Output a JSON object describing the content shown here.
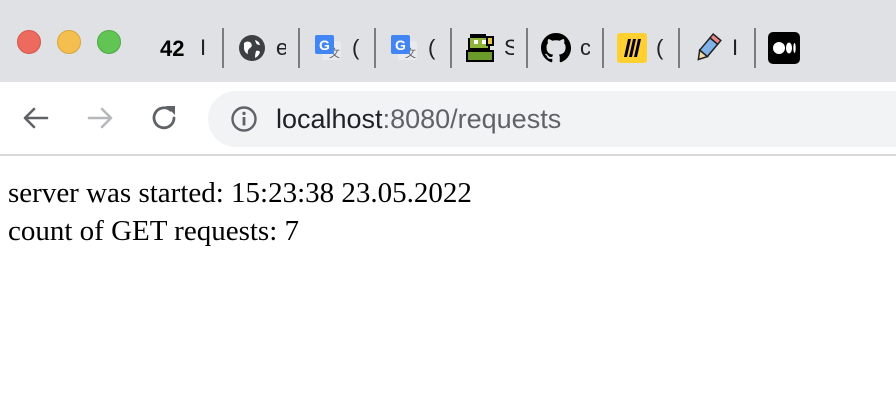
{
  "tabs": [
    {
      "icon": "42-logo-icon",
      "title": "I"
    },
    {
      "icon": "globe-icon",
      "title": "e"
    },
    {
      "icon": "google-translate-icon",
      "title": "("
    },
    {
      "icon": "google-translate-icon",
      "title": "("
    },
    {
      "icon": "pixel-art-icon",
      "title": "S"
    },
    {
      "icon": "github-icon",
      "title": "c"
    },
    {
      "icon": "miro-icon",
      "title": "("
    },
    {
      "icon": "pencil-icon",
      "title": "I"
    },
    {
      "icon": "medium-icon",
      "title": ""
    }
  ],
  "address_bar": {
    "host": "localhost",
    "path": ":8080/requests"
  },
  "page": {
    "line1": "server was started: 15:23:38 23.05.2022",
    "line2": "count of GET requests: 7"
  },
  "colors": {
    "tabbar_bg": "#dfe1e5",
    "omnibox_bg": "#f1f3f4",
    "close": "#ed6a5e",
    "minimize": "#f5bf4f",
    "maximize": "#61c554"
  }
}
